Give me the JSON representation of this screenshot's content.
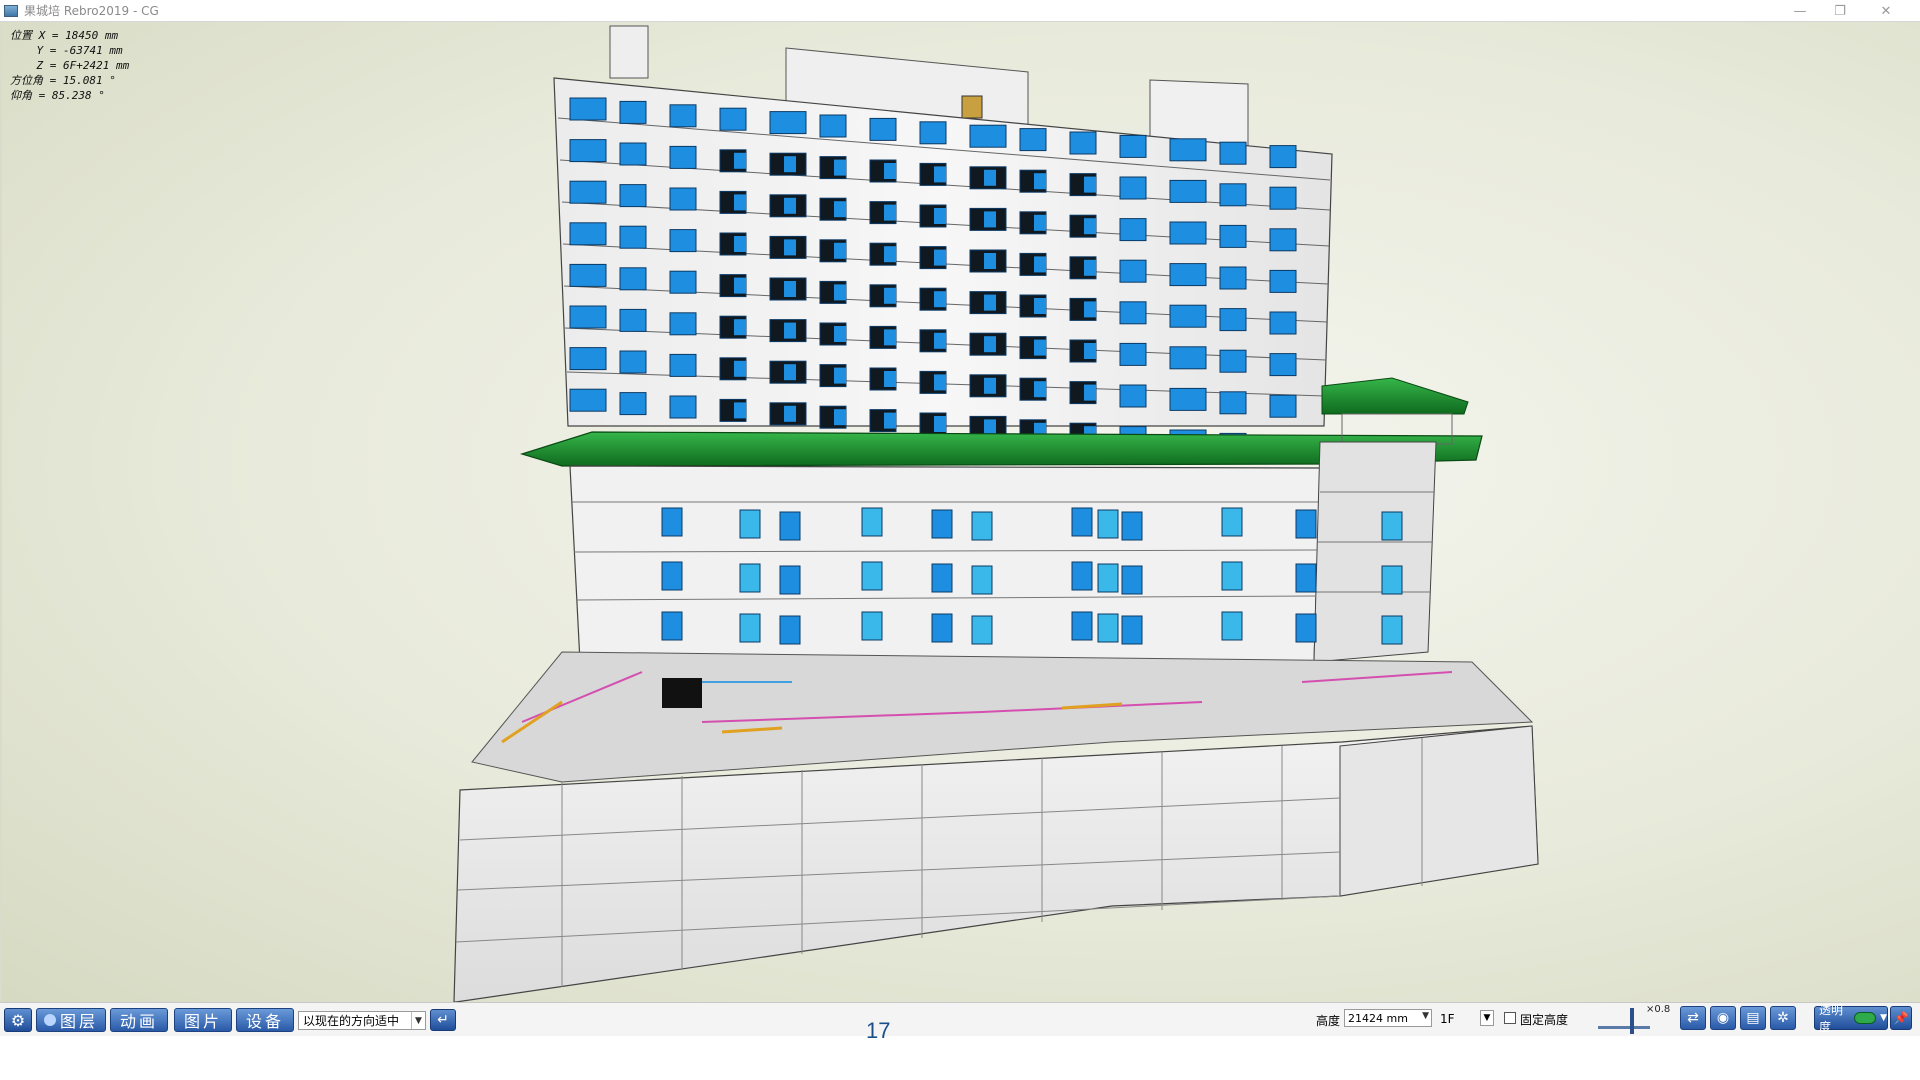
{
  "window": {
    "title": "果城培 Rebro2019 - CG"
  },
  "viewport": {
    "coords": {
      "line1": "位置 X = 18450 mm",
      "line2": "    Y = -63741 mm",
      "line3": "    Z = 6F+2421 mm",
      "line4": "方位角 = 15.081 °",
      "line5": "仰角 = 85.238 °"
    }
  },
  "toolbar": {
    "layers_label": "图层",
    "animation_label": "动画",
    "picture_label": "图片",
    "equipment_label": "设备",
    "view_select_value": "以现在的方向适中",
    "height_label": "高度",
    "height_value": "21424 mm",
    "floor_value": "1F",
    "fixed_height_label": "固定高度",
    "zoom_value": "×0.8",
    "opacity_label": "透明度"
  },
  "page_number": "17",
  "colors": {
    "window_blue": "#1e8fe0",
    "roof_green": "#1f8a2c",
    "toolbar_blue": "#2a5aa8"
  },
  "icons": {
    "settings": "gear-icon",
    "enter": "enter-icon",
    "camera": "camera-icon",
    "print": "print-icon",
    "swap": "swap-icon"
  }
}
